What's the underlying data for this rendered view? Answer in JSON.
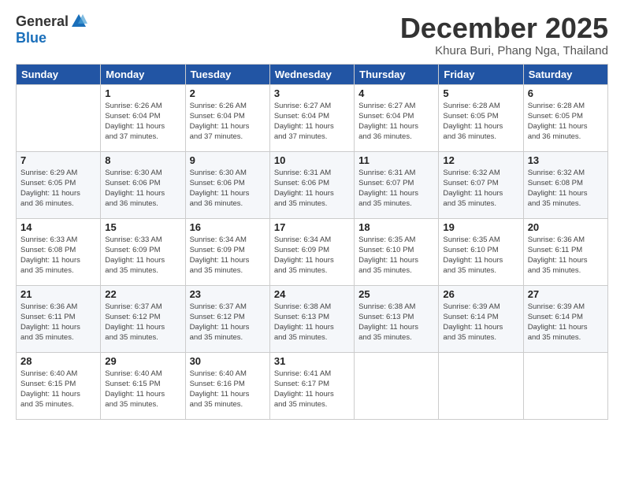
{
  "logo": {
    "general": "General",
    "blue": "Blue"
  },
  "title": "December 2025",
  "subtitle": "Khura Buri, Phang Nga, Thailand",
  "days_of_week": [
    "Sunday",
    "Monday",
    "Tuesday",
    "Wednesday",
    "Thursday",
    "Friday",
    "Saturday"
  ],
  "weeks": [
    [
      {
        "day": "",
        "info": ""
      },
      {
        "day": "1",
        "info": "Sunrise: 6:26 AM\nSunset: 6:04 PM\nDaylight: 11 hours\nand 37 minutes."
      },
      {
        "day": "2",
        "info": "Sunrise: 6:26 AM\nSunset: 6:04 PM\nDaylight: 11 hours\nand 37 minutes."
      },
      {
        "day": "3",
        "info": "Sunrise: 6:27 AM\nSunset: 6:04 PM\nDaylight: 11 hours\nand 37 minutes."
      },
      {
        "day": "4",
        "info": "Sunrise: 6:27 AM\nSunset: 6:04 PM\nDaylight: 11 hours\nand 36 minutes."
      },
      {
        "day": "5",
        "info": "Sunrise: 6:28 AM\nSunset: 6:05 PM\nDaylight: 11 hours\nand 36 minutes."
      },
      {
        "day": "6",
        "info": "Sunrise: 6:28 AM\nSunset: 6:05 PM\nDaylight: 11 hours\nand 36 minutes."
      }
    ],
    [
      {
        "day": "7",
        "info": "Sunrise: 6:29 AM\nSunset: 6:05 PM\nDaylight: 11 hours\nand 36 minutes."
      },
      {
        "day": "8",
        "info": "Sunrise: 6:30 AM\nSunset: 6:06 PM\nDaylight: 11 hours\nand 36 minutes."
      },
      {
        "day": "9",
        "info": "Sunrise: 6:30 AM\nSunset: 6:06 PM\nDaylight: 11 hours\nand 36 minutes."
      },
      {
        "day": "10",
        "info": "Sunrise: 6:31 AM\nSunset: 6:06 PM\nDaylight: 11 hours\nand 35 minutes."
      },
      {
        "day": "11",
        "info": "Sunrise: 6:31 AM\nSunset: 6:07 PM\nDaylight: 11 hours\nand 35 minutes."
      },
      {
        "day": "12",
        "info": "Sunrise: 6:32 AM\nSunset: 6:07 PM\nDaylight: 11 hours\nand 35 minutes."
      },
      {
        "day": "13",
        "info": "Sunrise: 6:32 AM\nSunset: 6:08 PM\nDaylight: 11 hours\nand 35 minutes."
      }
    ],
    [
      {
        "day": "14",
        "info": "Sunrise: 6:33 AM\nSunset: 6:08 PM\nDaylight: 11 hours\nand 35 minutes."
      },
      {
        "day": "15",
        "info": "Sunrise: 6:33 AM\nSunset: 6:09 PM\nDaylight: 11 hours\nand 35 minutes."
      },
      {
        "day": "16",
        "info": "Sunrise: 6:34 AM\nSunset: 6:09 PM\nDaylight: 11 hours\nand 35 minutes."
      },
      {
        "day": "17",
        "info": "Sunrise: 6:34 AM\nSunset: 6:09 PM\nDaylight: 11 hours\nand 35 minutes."
      },
      {
        "day": "18",
        "info": "Sunrise: 6:35 AM\nSunset: 6:10 PM\nDaylight: 11 hours\nand 35 minutes."
      },
      {
        "day": "19",
        "info": "Sunrise: 6:35 AM\nSunset: 6:10 PM\nDaylight: 11 hours\nand 35 minutes."
      },
      {
        "day": "20",
        "info": "Sunrise: 6:36 AM\nSunset: 6:11 PM\nDaylight: 11 hours\nand 35 minutes."
      }
    ],
    [
      {
        "day": "21",
        "info": "Sunrise: 6:36 AM\nSunset: 6:11 PM\nDaylight: 11 hours\nand 35 minutes."
      },
      {
        "day": "22",
        "info": "Sunrise: 6:37 AM\nSunset: 6:12 PM\nDaylight: 11 hours\nand 35 minutes."
      },
      {
        "day": "23",
        "info": "Sunrise: 6:37 AM\nSunset: 6:12 PM\nDaylight: 11 hours\nand 35 minutes."
      },
      {
        "day": "24",
        "info": "Sunrise: 6:38 AM\nSunset: 6:13 PM\nDaylight: 11 hours\nand 35 minutes."
      },
      {
        "day": "25",
        "info": "Sunrise: 6:38 AM\nSunset: 6:13 PM\nDaylight: 11 hours\nand 35 minutes."
      },
      {
        "day": "26",
        "info": "Sunrise: 6:39 AM\nSunset: 6:14 PM\nDaylight: 11 hours\nand 35 minutes."
      },
      {
        "day": "27",
        "info": "Sunrise: 6:39 AM\nSunset: 6:14 PM\nDaylight: 11 hours\nand 35 minutes."
      }
    ],
    [
      {
        "day": "28",
        "info": "Sunrise: 6:40 AM\nSunset: 6:15 PM\nDaylight: 11 hours\nand 35 minutes."
      },
      {
        "day": "29",
        "info": "Sunrise: 6:40 AM\nSunset: 6:15 PM\nDaylight: 11 hours\nand 35 minutes."
      },
      {
        "day": "30",
        "info": "Sunrise: 6:40 AM\nSunset: 6:16 PM\nDaylight: 11 hours\nand 35 minutes."
      },
      {
        "day": "31",
        "info": "Sunrise: 6:41 AM\nSunset: 6:17 PM\nDaylight: 11 hours\nand 35 minutes."
      },
      {
        "day": "",
        "info": ""
      },
      {
        "day": "",
        "info": ""
      },
      {
        "day": "",
        "info": ""
      }
    ]
  ]
}
